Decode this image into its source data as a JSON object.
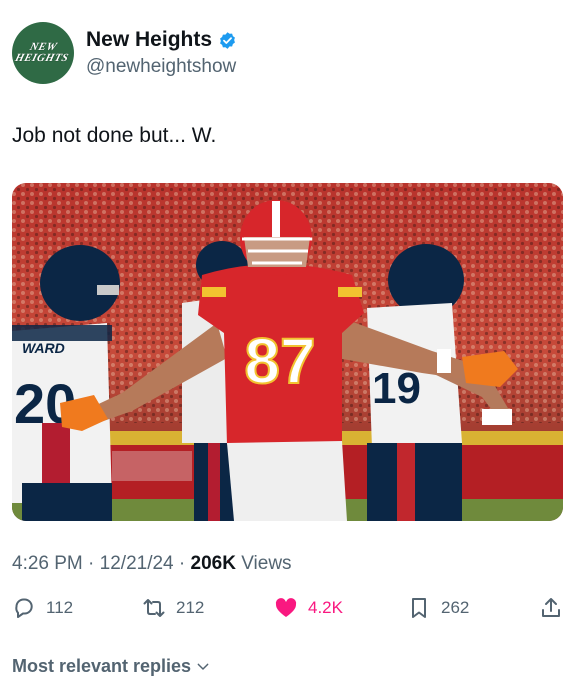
{
  "profile": {
    "avatar_text_line1": "NEW",
    "avatar_text_line2": "HEIGHTS",
    "display_name": "New Heights",
    "handle": "@newheightshow"
  },
  "tweet": {
    "text": "Job not done but... W.",
    "time": "4:26 PM",
    "sep": "·",
    "date": "12/21/24",
    "views_count": "206K",
    "views_label": "Views"
  },
  "actions": {
    "replies": "112",
    "retweets": "212",
    "likes": "4.2K",
    "bookmarks": "262"
  },
  "photo_text": {
    "jersey_number": "87",
    "left_player_name": "WARD",
    "left_player_number": "20"
  },
  "replies_sort_label": "Most relevant replies",
  "colors": {
    "like": "#f91880",
    "verified": "#1d9bf0",
    "avatar_bg": "#2f6a45",
    "chiefs_red": "#d7262b"
  }
}
